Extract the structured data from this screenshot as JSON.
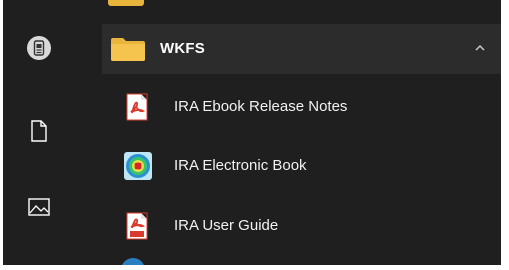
{
  "rail": {
    "icons": [
      "user-avatar-icon",
      "document-icon",
      "pictures-icon"
    ]
  },
  "group": {
    "label": "WKFS",
    "icon": "folder-icon",
    "folder_color": "#e9b43c",
    "expanded": true
  },
  "items": [
    {
      "label": "IRA Ebook Release Notes",
      "icon": "pdf-icon"
    },
    {
      "label": "IRA Electronic Book",
      "icon": "app-target-icon"
    },
    {
      "label": "IRA User Guide",
      "icon": "pdf-icon"
    }
  ],
  "colors": {
    "background": "#1f1f1f",
    "group_highlight": "#2c2c2c",
    "pdf_red": "#d83b2d"
  }
}
